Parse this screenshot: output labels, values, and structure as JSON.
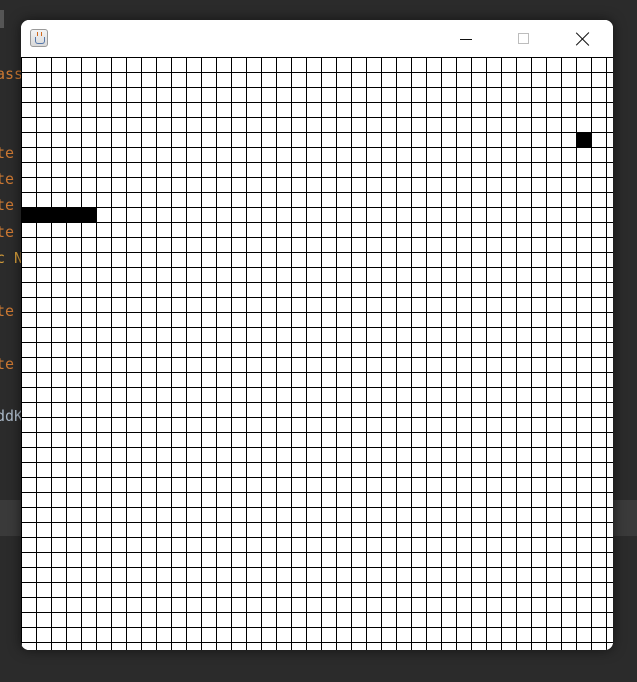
{
  "background_editor": {
    "lines": [
      {
        "text": "ass",
        "style": "orange"
      },
      {
        "text": "te",
        "style": "orange"
      },
      {
        "text": "te",
        "style": "orange"
      },
      {
        "text": "te",
        "style": "orange"
      },
      {
        "text": "te",
        "style": "orange"
      },
      {
        "text": "c N",
        "style": "yellow"
      },
      {
        "text": "te",
        "style": "orange"
      },
      {
        "text": "te",
        "style": "orange"
      },
      {
        "text": "ddK",
        "style": "plain"
      }
    ]
  },
  "window": {
    "title": "",
    "icon": "java-cup-icon",
    "controls": [
      "minimize-icon",
      "maximize-icon",
      "close-icon"
    ]
  },
  "game": {
    "grid_columns": 40,
    "grid_rows": 40,
    "snake": {
      "row": 10,
      "col_start": 0,
      "length": 5,
      "direction": "horizontal"
    },
    "food": {
      "row": 5,
      "col": 37
    },
    "colors": {
      "background": "#ffffff",
      "grid_line": "#000000",
      "snake": "#000000",
      "food": "#000000"
    }
  }
}
